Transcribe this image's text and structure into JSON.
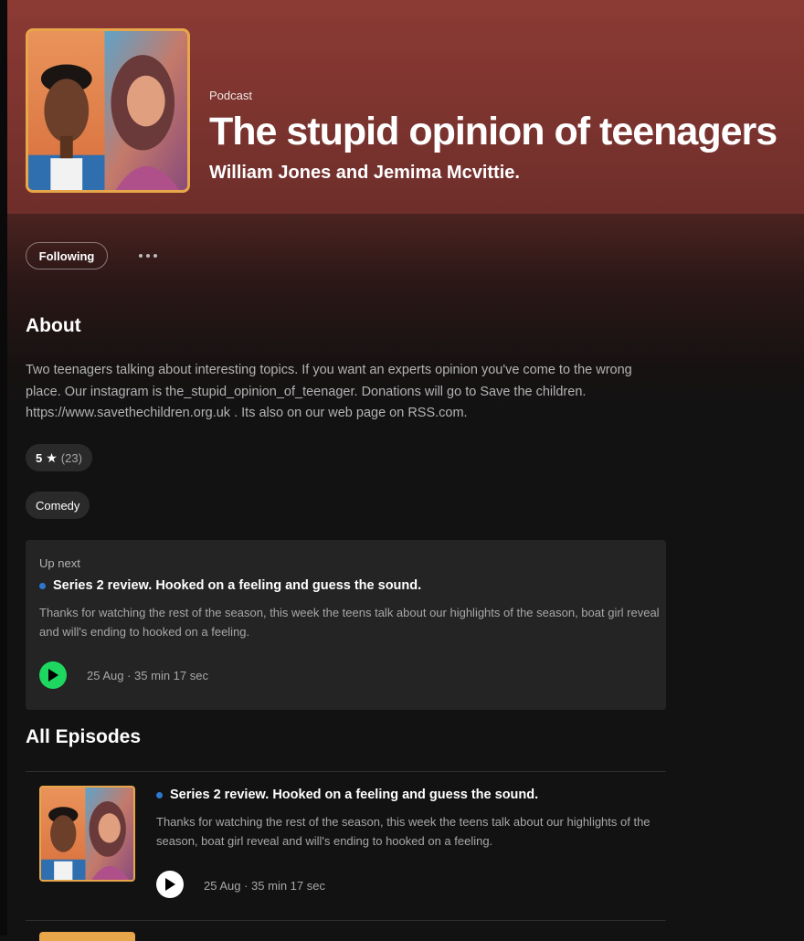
{
  "podcast": {
    "kind_label": "Podcast",
    "title": "The stupid opinion of teenagers",
    "authors": "William Jones and Jemima Mcvittie."
  },
  "actions": {
    "follow_label": "Following",
    "more_icon": "more-options-icon"
  },
  "about": {
    "heading": "About",
    "description": "Two teenagers talking about interesting topics. If you want an experts opinion you've come to the wrong place. Our instagram is the_stupid_opinion_of_teenager. Donations will go to Save the children. https://www.savethechildren.org.uk . Its also on our web page on RSS.com.",
    "rating_value": "5",
    "rating_icon": "star-icon",
    "rating_count": "(23)",
    "category": "Comedy"
  },
  "up_next": {
    "label": "Up next",
    "title": "Series 2 review. Hooked on a feeling and guess the sound.",
    "description": "Thanks for watching the rest of the season, this week the teens talk about our highlights of the season, boat girl reveal and will's ending to hooked on a feeling.",
    "meta": "25 Aug · 35 min 17 sec"
  },
  "episodes": {
    "heading": "All Episodes",
    "items": [
      {
        "title": "Series 2 review. Hooked on a feeling and guess the sound.",
        "description": "Thanks for watching the rest of the season, this week the teens talk about our highlights of the season, boat girl reveal and will's ending to hooked on a feeling.",
        "meta": "25 Aug · 35 min 17 sec"
      }
    ]
  },
  "colors": {
    "header": "#8c3a34",
    "accent_green": "#1ed760",
    "new_dot": "#2e77d0",
    "cover_border": "#e8a64a"
  }
}
